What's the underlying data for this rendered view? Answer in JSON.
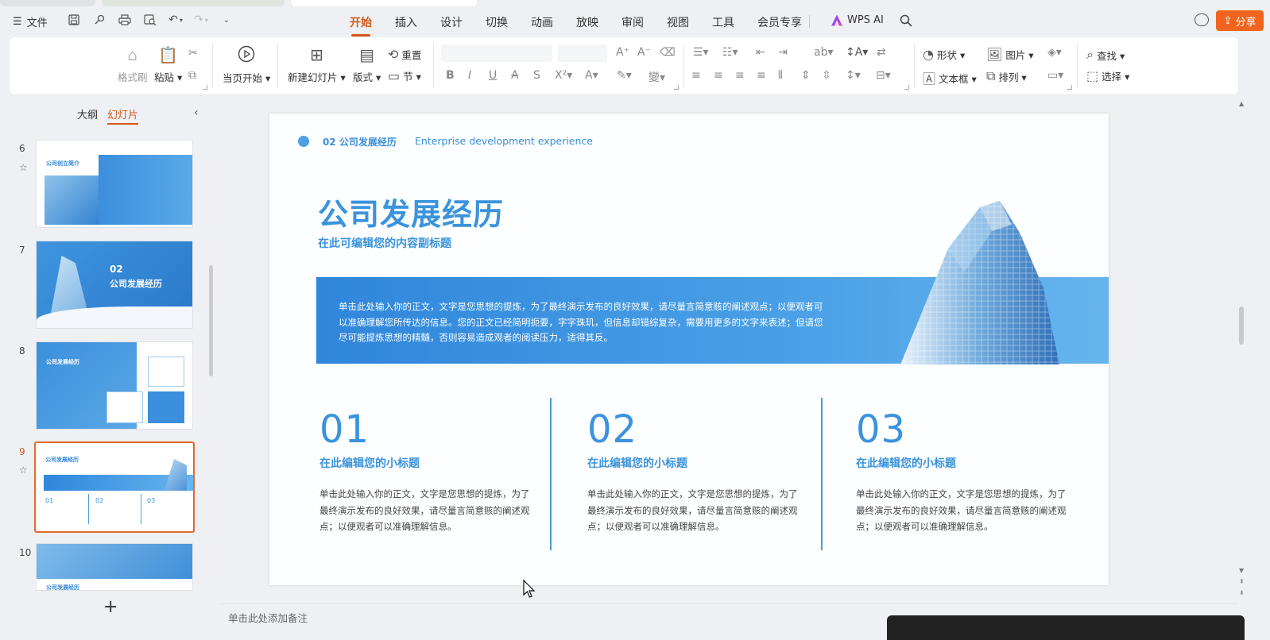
{
  "topbar": {
    "file_label": "文件",
    "tabs": [
      "开始",
      "插入",
      "设计",
      "切换",
      "动画",
      "放映",
      "审阅",
      "视图",
      "工具",
      "会员专享"
    ],
    "active_tab": "开始",
    "wps_ai_label": "WPS AI",
    "share_label": "分享",
    "accent_color": "#d4591c",
    "share_color": "#f0641e"
  },
  "ribbon": {
    "format_painter": "格式刷",
    "paste": "粘贴",
    "from_current": "当页开始",
    "new_slide": "新建幻灯片",
    "layout": "版式",
    "reset": "重置",
    "section": "节",
    "shape": "形状",
    "picture": "图片",
    "textbox": "文本框",
    "arrange": "排列",
    "find": "查找",
    "select": "选择"
  },
  "left_panel": {
    "tab_outline": "大纲",
    "tab_slides": "幻灯片",
    "slides": [
      {
        "num": "6",
        "title": "公司创立简介"
      },
      {
        "num": "7",
        "title": "02\n公司发展经历",
        "big_num": "02",
        "big_title": "公司发展经历"
      },
      {
        "num": "8",
        "title": "公司发展经历"
      },
      {
        "num": "9",
        "title": "公司发展经历",
        "current": true,
        "cols": [
          "01",
          "02",
          "03"
        ]
      },
      {
        "num": "10",
        "title": "公司发展经历"
      }
    ],
    "add_label": "+"
  },
  "slide": {
    "section_label": "02 公司发展经历",
    "section_en": "Enterprise development experience",
    "title": "公司发展经历",
    "subtitle": "在此可编辑您的内容副标题",
    "band_text": "单击此处输入你的正文，文字是您思想的提炼，为了最终演示发布的良好效果，请尽量言简意赅的阐述观点；以便观者可以准确理解您所传达的信息。您的正文已经简明扼要，字字珠玑，但信息却错综复杂，需要用更多的文字来表述；但请您尽可能提炼思想的精髓，否则容易造成观者的阅读压力，适得其反。",
    "columns": [
      {
        "num": "01",
        "heading": "在此编辑您的小标题",
        "body": "单击此处输入你的正文，文字是您思想的提炼，为了最终演示发布的良好效果，请尽量言简意赅的阐述观点；以便观者可以准确理解信息。"
      },
      {
        "num": "02",
        "heading": "在此编辑您的小标题",
        "body": "单击此处输入你的正文，文字是您思想的提炼，为了最终演示发布的良好效果，请尽量言简意赅的阐述观点；以便观者可以准确理解信息。"
      },
      {
        "num": "03",
        "heading": "在此编辑您的小标题",
        "body": "单击此处输入你的正文，文字是您思想的提炼，为了最终演示发布的良好效果，请尽量言简意赅的阐述观点；以便观者可以准确理解信息。"
      }
    ],
    "theme_color": "#3a93dd"
  },
  "notes": {
    "placeholder": "单击此处添加备注"
  }
}
